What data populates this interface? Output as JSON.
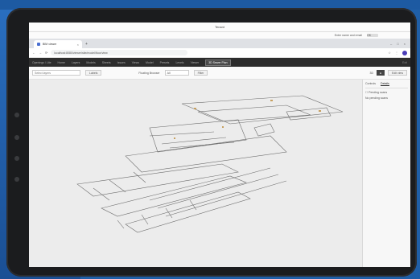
{
  "system": {
    "title": "Tenant",
    "notification": "Enter name and email",
    "notification_button": "OK"
  },
  "browser": {
    "tab_title": "BIM viewer",
    "tab_close": "×",
    "new_tab": "+",
    "window_controls": [
      "–",
      "□",
      "×"
    ],
    "nav_icons": [
      "←",
      "→",
      "⟳"
    ],
    "url": "localhost:8080/viewer/site/model/floor/view"
  },
  "app_nav": {
    "items": [
      "Openings / Lite",
      "Home",
      "Layers",
      "Models",
      "Sheets",
      "Issues",
      "Views",
      "Model",
      "Presets",
      "Levels",
      "Viewer",
      "3D Sewer Plan"
    ],
    "active_index": 11,
    "right_label": "Exit"
  },
  "toolbar": {
    "search_placeholder": "Select layers",
    "button_label": "Labels",
    "dropdown_label": "Floating Browser",
    "dropdown_value": "All",
    "filter_button": "Filter",
    "toggle_label": "3D",
    "export_button": "Edit view"
  },
  "panel": {
    "tabs": [
      "Controls",
      "Details"
    ],
    "active_tab": 1,
    "heading": "Pending scans",
    "empty_text": "No pending scans"
  }
}
